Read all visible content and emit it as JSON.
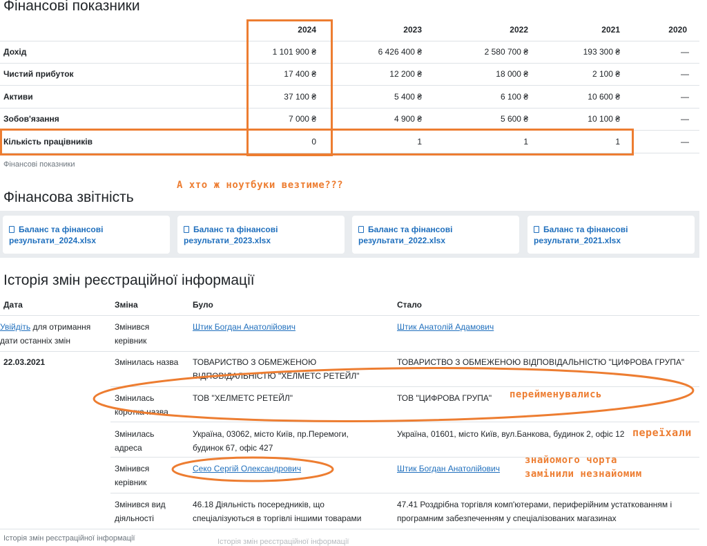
{
  "fin": {
    "title": "Фінансові показники",
    "years": [
      "2024",
      "2023",
      "2022",
      "2021",
      "2020"
    ],
    "rows": [
      {
        "label": "Дохід",
        "values": [
          "1 101 900 ₴",
          "6 426 400 ₴",
          "2 580 700 ₴",
          "193 300 ₴",
          "—"
        ]
      },
      {
        "label": "Чистий прибуток",
        "values": [
          "17 400 ₴",
          "12 200 ₴",
          "18 000 ₴",
          "2 100 ₴",
          "—"
        ]
      },
      {
        "label": "Активи",
        "values": [
          "37 100 ₴",
          "5 400 ₴",
          "6 100 ₴",
          "10 600 ₴",
          "—"
        ]
      },
      {
        "label": "Зобов'язання",
        "values": [
          "7 000 ₴",
          "4 900 ₴",
          "5 600 ₴",
          "10 100 ₴",
          "—"
        ]
      },
      {
        "label": "Кількість працівників",
        "values": [
          "0",
          "1",
          "1",
          "1",
          "—"
        ]
      }
    ],
    "caption": "Фінансові показники"
  },
  "reports": {
    "title": "Фінансова звітність",
    "files": [
      {
        "line1": "Баланс та фінансові",
        "line2": "результати_2024.xlsx"
      },
      {
        "line1": "Баланс та фінансові",
        "line2": "результати_2023.xlsx"
      },
      {
        "line1": "Баланс та фінансові",
        "line2": "результати_2022.xlsx"
      },
      {
        "line1": "Баланс та фінансові",
        "line2": "результати_2021.xlsx"
      }
    ]
  },
  "history": {
    "title": "Історія змін реєстраційної інформації",
    "headers": {
      "date": "Дата",
      "change": "Зміна",
      "was": "Було",
      "became": "Стало"
    },
    "login_row": {
      "login_link": "Увійдіть",
      "login_rest": "для отримання",
      "login_line2": "дати останніх змін",
      "change": [
        "Змінився",
        "керівник"
      ],
      "was": "Штик Богдан Анатолійович",
      "became": "Штик Анатолій Адамович"
    },
    "date": "22.03.2021",
    "rows": [
      {
        "change": [
          "Змінилась назва"
        ],
        "was": [
          "ТОВАРИСТВО З ОБМЕЖЕНОЮ",
          "ВІДПОВІДАЛЬНІСТЮ \"ХЕЛМЕТС РЕТЕЙЛ\""
        ],
        "became": [
          "ТОВАРИСТВО З ОБМЕЖЕНОЮ ВІДПОВІДАЛЬНІСТЮ \"ЦИФРОВА ГРУПА\""
        ]
      },
      {
        "change": [
          "Змінилась",
          "коротка назва"
        ],
        "was": [
          "ТОВ \"ХЕЛМЕТС РЕТЕЙЛ\""
        ],
        "became": [
          "ТОВ \"ЦИФРОВА ГРУПА\""
        ]
      },
      {
        "change": [
          "Змінилась",
          "адреса"
        ],
        "was": [
          "Україна, 03062, місто Київ, пр.Перемоги,",
          "будинок 67, офіс 427"
        ],
        "became": [
          "Україна, 01601, місто Київ, вул.Банкова, будинок 2, офіс 12"
        ]
      },
      {
        "change": [
          "Змінився",
          "керівник"
        ],
        "was_link": "Секо Сергій Олександрович",
        "became_link": "Штик Богдан Анатолійович"
      },
      {
        "change": [
          "Змінився вид",
          "діяльності"
        ],
        "was": [
          "46.18 Діяльність посередників, що",
          "спеціалізуються в торгівлі іншими товарами"
        ],
        "became": [
          "47.41 Роздрібна торгівля комп'ютерами, периферійним устаткованням і",
          "програмним забезпеченням у спеціалізованих магазинах"
        ]
      }
    ],
    "caption": "Історія змін реєстраційної інформації",
    "caption_faded": "Історія змін реєстраційної інформації"
  },
  "annotations": {
    "laptops": "А хто ж ноутбуки везтиме???",
    "renamed": "перейменувались",
    "moved": "переїхали",
    "replaced_line1": "знайомого чорта",
    "replaced_line2": "замінили незнайомим"
  },
  "colors": {
    "annotation": "#ed7d31",
    "link": "#1f6fbd"
  }
}
